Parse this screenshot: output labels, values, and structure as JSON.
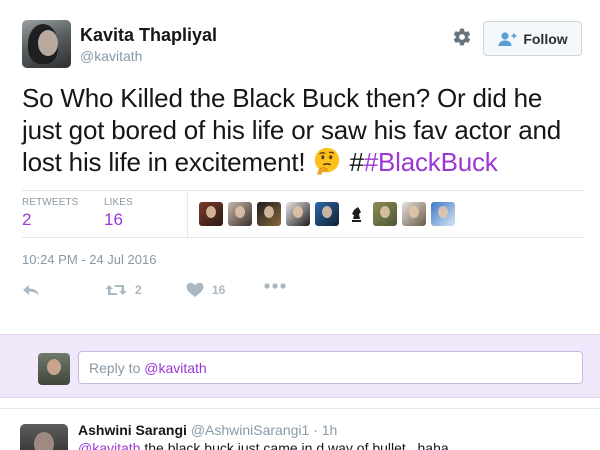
{
  "tweet": {
    "author": {
      "display_name": "Kavita Thapliyal",
      "handle": "@kavitath"
    },
    "follow_label": "Follow",
    "text_main": "So Who Killed the Black Buck then? Or did he just got bored of his life or saw his fav actor and lost his life in excitement!",
    "emoji": "thinking-face",
    "hash_prefix": "#",
    "hashtag": "#BlackBuck",
    "stats": {
      "retweets_label": "RETWEETS",
      "retweets_count": "2",
      "likes_label": "LIKES",
      "likes_count": "16"
    },
    "likers": [
      "liker-1",
      "liker-2",
      "liker-3",
      "liker-4",
      "liker-5",
      "liker-6",
      "liker-7",
      "liker-8",
      "liker-9"
    ],
    "timestamp": "10:24 PM - 24 Jul 2016",
    "actions": {
      "reply_icon": "reply-icon",
      "retweet_count": "2",
      "like_count": "16",
      "more_icon": "more-icon"
    }
  },
  "reply_composer": {
    "prefix": "Reply to ",
    "mention": "@kavitath"
  },
  "reply_tweet": {
    "display_name": "Ashwini Sarangi",
    "handle": "@AshwiniSarangi1",
    "time": "· 1h",
    "mention": "@kavitath",
    "text": " the black buck just came in d way of bullet.. haha"
  },
  "colors": {
    "accent": "#9b37d4",
    "muted": "#8899a6",
    "reply_bg": "#f1e7fa"
  }
}
